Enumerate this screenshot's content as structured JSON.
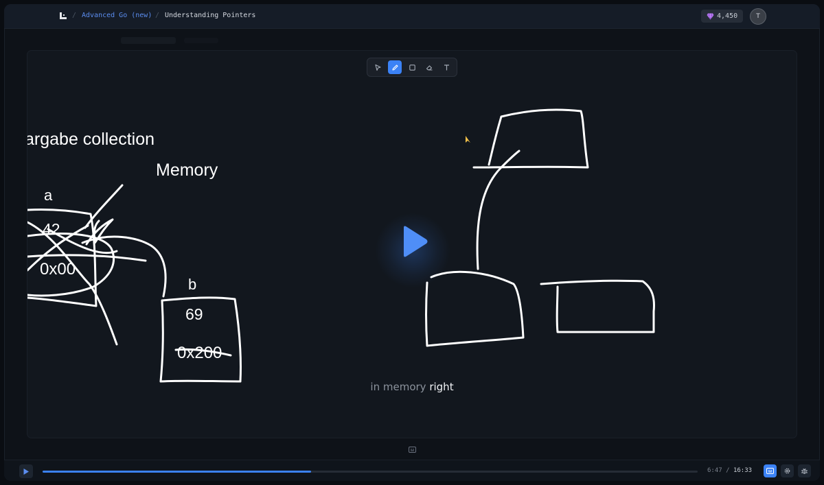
{
  "header": {
    "course": "Advanced Go (new)",
    "lesson": "Understanding Pointers",
    "separator": "/",
    "gems": "4,450",
    "avatar_initial": "T"
  },
  "whiteboard": {
    "tools": [
      "select-tool",
      "pen-tool",
      "rectangle-tool",
      "eraser-tool",
      "text-tool"
    ],
    "active_tool": "pen-tool",
    "texts": {
      "gc": "argabe collection",
      "memory": "Memory",
      "var_a": "a",
      "val_a": "42",
      "addr_a": "0x00",
      "var_b": "b",
      "val_b": "69",
      "addr_b": "0x200"
    }
  },
  "caption": {
    "dim": "in memory",
    "bright": "right"
  },
  "player": {
    "current_time": "6:47",
    "time_separator": "/",
    "total_time": "16:33",
    "progress": 0.41,
    "captions_on": true
  },
  "colors": {
    "accent": "#3b82f6",
    "course_link": "#5b8def",
    "gem": "#c084fc"
  }
}
